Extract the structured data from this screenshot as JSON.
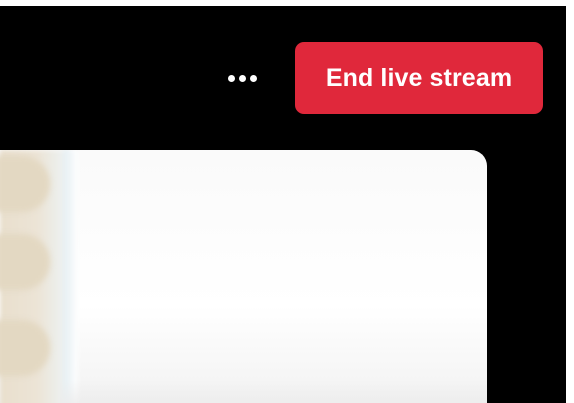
{
  "header": {
    "more_options_icon": "ellipsis-icon",
    "end_stream_label": "End live stream"
  },
  "colors": {
    "background": "#000000",
    "end_button": "#e0283b",
    "end_button_text": "#ffffff"
  }
}
